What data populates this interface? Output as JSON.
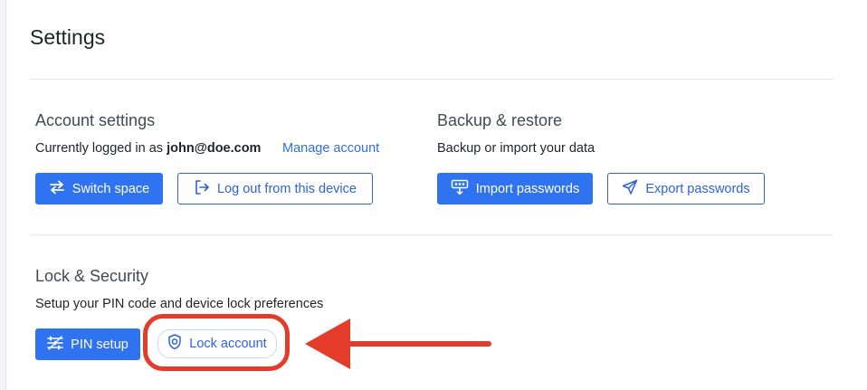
{
  "page": {
    "title": "Settings"
  },
  "account": {
    "heading": "Account settings",
    "logged_in_prefix": "Currently logged in as",
    "email": "john@doe.com",
    "manage_link": "Manage account",
    "switch_space_label": "Switch space",
    "logout_label": "Log out from this device"
  },
  "backup": {
    "heading": "Backup & restore",
    "description": "Backup or import your data",
    "import_label": "Import passwords",
    "export_label": "Export passwords"
  },
  "security": {
    "heading": "Lock & Security",
    "description": "Setup your PIN code and device lock preferences",
    "pin_label": "PIN setup",
    "lock_label": "Lock account"
  },
  "colors": {
    "primary": "#2f73f0",
    "link": "#2e6ee6",
    "annotation": "#e43b2a"
  },
  "icons": [
    "switch-icon",
    "logout-icon",
    "import-icon",
    "send-icon",
    "pin-icon",
    "shield-icon",
    "annotation-arrow"
  ]
}
